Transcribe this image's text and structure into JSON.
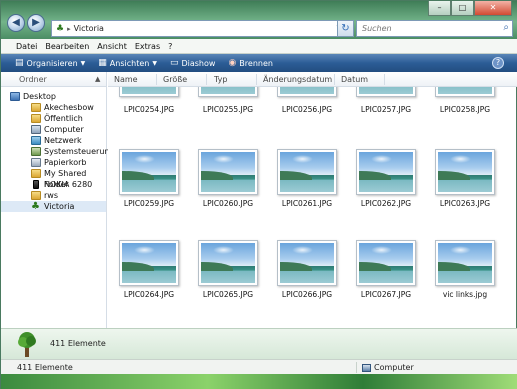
{
  "window": {
    "controls": [
      "–",
      "□",
      "✕"
    ]
  },
  "address": {
    "path_separator": "▸",
    "path": "Victoria",
    "search_placeholder": "Suchen"
  },
  "menu": [
    "Datei",
    "Bearbeiten",
    "Ansicht",
    "Extras",
    "?"
  ],
  "toolbar": {
    "organize": "Organisieren",
    "views": "Ansichten",
    "slideshow": "Diashow",
    "burn": "Brennen",
    "help": "?"
  },
  "sidebar": {
    "header": "Ordner",
    "items": [
      {
        "label": "Desktop",
        "icon": "desktop-icon"
      },
      {
        "label": "Akechesbow",
        "icon": "folder-icon"
      },
      {
        "label": "Öffentlich",
        "icon": "folder-icon"
      },
      {
        "label": "Computer",
        "icon": "computer-icon"
      },
      {
        "label": "Netzwerk",
        "icon": "network-icon"
      },
      {
        "label": "Systemsteuerung",
        "icon": "control-panel-icon"
      },
      {
        "label": "Papierkorb",
        "icon": "recycle-bin-icon"
      },
      {
        "label": "My Shared Folder",
        "icon": "shared-folder-icon"
      },
      {
        "label": "NOKIA 6280",
        "icon": "phone-icon"
      },
      {
        "label": "rws",
        "icon": "folder-icon"
      },
      {
        "label": "Victoria",
        "icon": "tree-icon"
      }
    ]
  },
  "columns": [
    "Name",
    "Größe",
    "Typ",
    "Änderungsdatum",
    "Datum"
  ],
  "files": [
    "LPIC0254.JPG",
    "LPIC0255.JPG",
    "LPIC0256.JPG",
    "LPIC0257.JPG",
    "LPIC0258.JPG",
    "LPIC0259.JPG",
    "LPIC0260.JPG",
    "LPIC0261.JPG",
    "LPIC0262.JPG",
    "LPIC0263.JPG",
    "LPIC0264.JPG",
    "LPIC0265.JPG",
    "LPIC0266.JPG",
    "LPIC0267.JPG",
    "vic links.jpg"
  ],
  "details": {
    "count_text": "411 Elemente"
  },
  "status": {
    "left": "411 Elemente",
    "right": "Computer"
  }
}
